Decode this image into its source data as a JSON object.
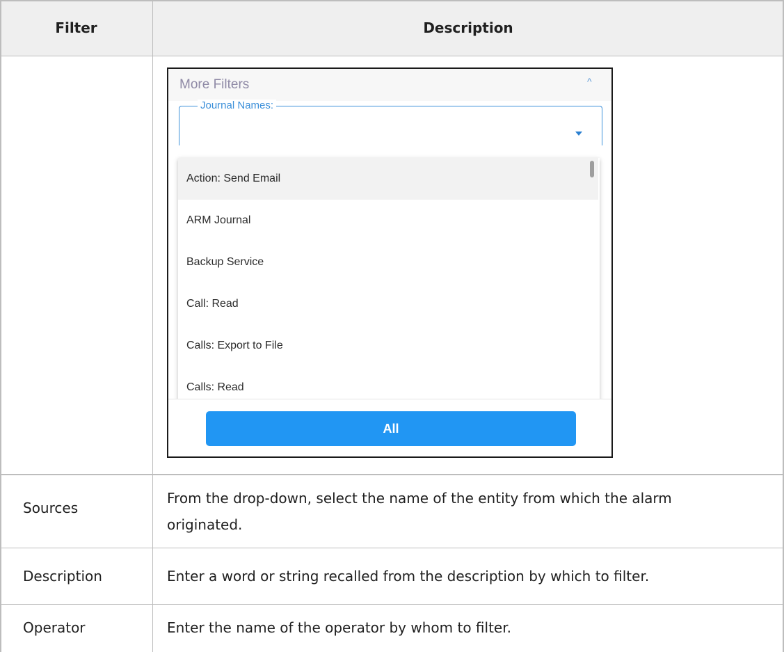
{
  "table": {
    "headers": {
      "filter": "Filter",
      "description": "Description"
    },
    "rows": [
      {
        "filter": "",
        "description": ""
      },
      {
        "filter": "Sources",
        "description_lines": [
          "From the drop-down, select the name of the entity from which the alarm",
          "originated."
        ]
      },
      {
        "filter": "Description",
        "description": "Enter a word or string recalled from the description by which to filter."
      },
      {
        "filter": "Operator",
        "description": "Enter the name of the operator by whom to filter."
      }
    ]
  },
  "screenshot": {
    "more_filters_title": "More Filters",
    "collapse_glyph": "^",
    "journal_names_label": "Journal Names:",
    "dropdown_items": [
      "Action: Send Email",
      "ARM Journal",
      "Backup Service",
      "Call: Read",
      "Calls: Export to File",
      "Calls: Read"
    ],
    "all_button_label": "All",
    "accent_color": "#2196f3"
  }
}
